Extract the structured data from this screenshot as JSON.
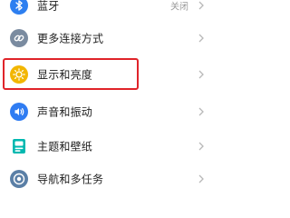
{
  "settings": {
    "items": [
      {
        "label": "蓝牙",
        "value": "关闭",
        "icon": "bluetooth-icon",
        "icon_color": "#2d7ff0"
      },
      {
        "label": "更多连接方式",
        "value": "",
        "icon": "link-icon",
        "icon_color": "#7a8ba0"
      },
      {
        "label": "显示和亮度",
        "value": "",
        "icon": "brightness-icon",
        "icon_color": "#f2b600"
      },
      {
        "label": "声音和振动",
        "value": "",
        "icon": "sound-icon",
        "icon_color": "#2f7cf2"
      },
      {
        "label": "主题和壁纸",
        "value": "",
        "icon": "theme-icon",
        "icon_color": "#00b8b0"
      },
      {
        "label": "导航和多任务",
        "value": "",
        "icon": "navigation-icon",
        "icon_color": "#5a7fa6"
      }
    ]
  },
  "highlight": {
    "color": "#e0242a"
  }
}
